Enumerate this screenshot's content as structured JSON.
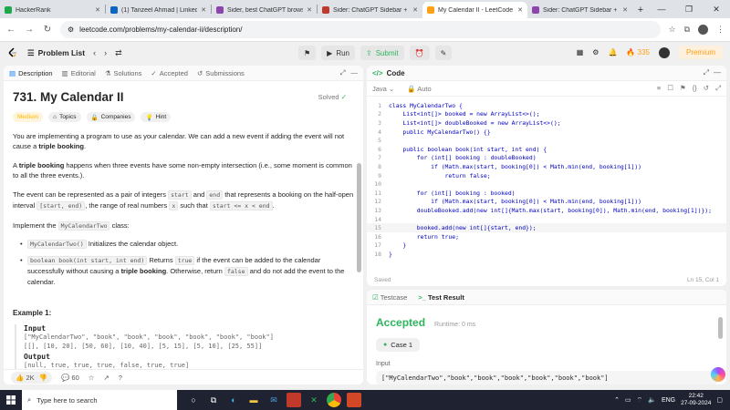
{
  "browser": {
    "tabs": [
      {
        "label": "HackerRank",
        "color": "#1ba94c"
      },
      {
        "label": "(1) Tanzeel Ahmad | Linked",
        "color": "#0a66c2"
      },
      {
        "label": "Sider, best ChatGPT brows",
        "color": "#8e44ad"
      },
      {
        "label": "Sider: ChatGPT Sidebar + G",
        "color": "#c0392b"
      },
      {
        "label": "My Calendar II - LeetCode",
        "color": "#ffa116"
      },
      {
        "label": "Sider: ChatGPT Sidebar + (",
        "color": "#8e44ad"
      }
    ],
    "url": "leetcode.com/problems/my-calendar-ii/description/"
  },
  "nav": {
    "problem_list": "Problem List",
    "run": "Run",
    "submit": "Submit",
    "streak": "335",
    "premium": "Premium"
  },
  "left": {
    "tabs": {
      "description": "Description",
      "editorial": "Editorial",
      "solutions": "Solutions",
      "accepted": "Accepted",
      "submissions": "Submissions"
    },
    "title": "731. My Calendar II",
    "solved": "Solved",
    "badges": {
      "difficulty": "Medium",
      "topics": "Topics",
      "companies": "Companies",
      "hint": "Hint"
    },
    "p1": {
      "a": "You are implementing a program to use as your calendar. We can add a new event if adding the event will not cause a ",
      "b": "triple booking",
      "c": "."
    },
    "p2": {
      "a": "A ",
      "b": "triple booking",
      "c": " happens when three events have some non-empty intersection (i.e., some moment is common to all the three events.)."
    },
    "p3": {
      "a": "The event can be represented as a pair of integers ",
      "start": "start",
      "and": " and ",
      "end": "end",
      "b": " that represents a booking on the half-open interval ",
      "interval": "[start, end)",
      "c": ", the range of real numbers ",
      "x": "x",
      "d": " such that ",
      "cond": "start <= x < end",
      "e": "."
    },
    "p4": {
      "a": "Implement the ",
      "cls": "MyCalendarTwo",
      "b": " class:"
    },
    "b1": {
      "code": "MyCalendarTwo()",
      "text": " Initializes the calendar object."
    },
    "b2": {
      "code": "boolean book(int start, int end)",
      "a": " Returns ",
      "true": "true",
      "b": " if the event can be added to the calendar successfully without causing a ",
      "tb": "triple booking",
      "c": ". Otherwise, return ",
      "false": "false",
      "d": " and do not add the event to the calendar."
    },
    "example": {
      "heading": "Example 1:",
      "input_label": "Input",
      "input_line1": "[\"MyCalendarTwo\", \"book\", \"book\", \"book\", \"book\", \"book\", \"book\"]",
      "input_line2": "[[], [10, 20], [50, 60], [10, 40], [5, 15], [5, 10], [25, 55]]",
      "output_label": "Output",
      "output_line": "[null, true, true, true, false, true, true]"
    },
    "footer": {
      "likes": "2K",
      "comments": "60"
    }
  },
  "code": {
    "title": "Code",
    "language": "Java",
    "mode": "Auto",
    "lines": [
      "class MyCalendarTwo {",
      "    List<int[]> booked = new ArrayList<>();",
      "    List<int[]> doubleBooked = new ArrayList<>();",
      "    public MyCalendarTwo() {}",
      "",
      "    public boolean book(int start, int end) {",
      "        for (int[] booking : doubleBooked)",
      "            if (Math.max(start, booking[0]) < Math.min(end, booking[1]))",
      "                return false;",
      "",
      "        for (int[] booking : booked)",
      "            if (Math.max(start, booking[0]) < Math.min(end, booking[1]))",
      "        doubleBooked.add(new int[]{Math.max(start, booking[0]), Math.min(end, booking[1])});",
      "",
      "        booked.add(new int[]{start, end});",
      "        return true;",
      "    }",
      "}"
    ],
    "saved": "Saved",
    "cursor": "Ln 15, Col 1"
  },
  "test": {
    "tab_testcase": "Testcase",
    "tab_result": "Test Result",
    "status": "Accepted",
    "runtime": "Runtime: 0 ms",
    "case": "Case 1",
    "input_label": "Input",
    "input_value": "[\"MyCalendarTwo\",\"book\",\"book\",\"book\",\"book\",\"book\",\"book\"]"
  },
  "taskbar": {
    "search": "Type here to search",
    "lang": "ENG",
    "time": "22:42",
    "date": "27-09-2024"
  }
}
